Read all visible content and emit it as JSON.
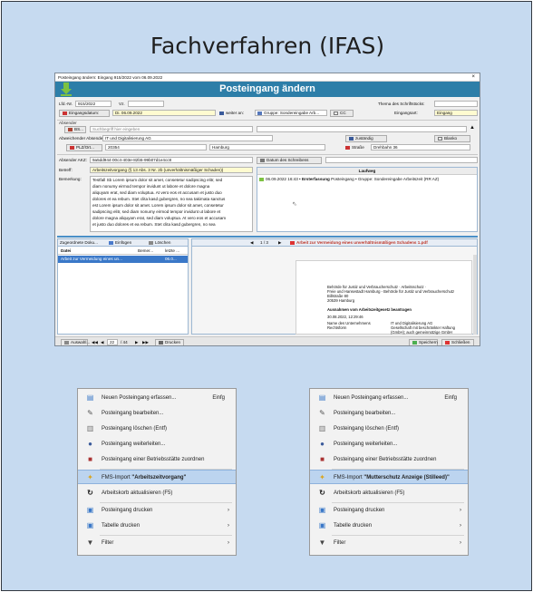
{
  "slide_title": "Fachverfahren (IFAS)",
  "window": {
    "titlebar": "Posteingang ändern: Eingang 915/2022 vom 06.09.2022",
    "close": "×",
    "header": "Posteingang ändern"
  },
  "form": {
    "lfd_label": "Lfd.-Nr.",
    "lfd_value": "915/2022",
    "vz_label": "Vz.",
    "theme_label": "Thema des Schriftstücks:",
    "eingangsdatum_label": "Eingangsdatum:",
    "eingangsdatum_value": "Di. 06.09.2022",
    "weiter_an": "weiter an:",
    "gruppe": "Gruppe: Sondereingabe Arb...",
    "cc": "CC",
    "eingangsart_label": "Eingangsart:",
    "eingangsart_value": "Eingang",
    "absender_label": "Absender",
    "bs": "BS...",
    "suchbegriff_placeholder": "Suchbegriff hier eingeben",
    "abw_absender_label": "Abweichender Absender:",
    "abw_absender_value": "IT und Digitalisierung AG",
    "zustaendig": "zuständig",
    "blanko": "Blanko",
    "plz_label": "PLZ/Ort...",
    "plz_value": "20354",
    "ort_value": "Hamburg",
    "strasse": "Straße",
    "strasse_value": "Drehbahn 36",
    "akz_label": "Absender AKZ:",
    "akz_value": "9a5dd944-00c4-403e-82b5-99b07d1e4cc8",
    "datum_schreiben": "Datum des Schreibens",
    "betreff_label": "Betreff:",
    "betreff_value": "Arbeitszeitvorgang (§ 13 Abs. 3 Nr. 2b (unverhältnismäßiger Schaden))",
    "bemerkung_label": "Bemerkung:",
    "bemerkung_text": [
      "Testfall Sb Lorem ipsum dolor sit amet, consetetur sadipscing elitr, sed",
      "diam nonumy eirmod tempor invidunt ut labore et dolore magna",
      "aliquyam erat, sed diam voluptua. At vero eos et accusam et justo duo",
      "dolores et ea rebum. Stet clita kasd gubergren, no sea takimata sanctus",
      "est Lorem ipsum dolor sit amet. Lorem ipsum dolor sit amet, consetetur",
      "sadipscing elitr, sed diam nonumy eirmod tempor invidunt ut labore et",
      "dolore magna aliquyam erat, sed diam voluptua. At vero eos et accusam",
      "et justo duo dolores et ea rebum. Stet clita kasd gubergren, no sea"
    ],
    "laufweg_header": "Laufweg",
    "laufweg_entry_date": "06.09.2022 16:43 •",
    "laufweg_entry_bold": "Ersterfassung",
    "laufweg_entry_rest": "Posteingang • Gruppe: Sondereingabe Arbeitszeit (RR AZ)"
  },
  "attachments": {
    "tab": "Zugeordnete Doku...",
    "einfuegen": "Einfügen",
    "loeschen": "Löschen",
    "col_datei": "Datei",
    "col_bemerkung": "Bemer...",
    "col_letzte": "letzte ...",
    "row_name": "Arbeit zur Vermeidung eines un...",
    "row_meta": "06.0..."
  },
  "viewer": {
    "page": "1 / 3",
    "filename": "Arbeit zur Vermeidung eines unverhältnismäßigen Schadens 1.pdf",
    "doc_lines": [
      "Behörde für Justiz und Verbraucherschutz · Arbeitsschutz ·",
      "Freie und Hansestadt Hamburg - Behörde für Justiz und Verbraucherschutz",
      "Billstraße 80",
      "20539 Hamburg"
    ],
    "doc_heading": "Ausnahmen vom Arbeitszeitgesetz beantragen",
    "doc_date": "30.08.2022, 12:29:46",
    "rows": [
      {
        "k": "Name des Unternehmens",
        "v": "IT und Digitalisierung AG"
      },
      {
        "k": "Rechtsform",
        "v": "Gesellschaft mit beschränkter Haftung"
      },
      {
        "k": "",
        "v": "(GmbH); auch gemeinnützige GmbH"
      },
      {
        "k": "",
        "v": "(gGmbH)"
      },
      {
        "k": "E-Mail",
        "v": "OnlineDienste@justiz.hamburg.de"
      }
    ]
  },
  "bottom": {
    "auswahl": "Auswahl...",
    "nav_pos": "22",
    "nav_total": "/ 44",
    "drucken": "Drucken",
    "speichern": "Speichern",
    "schliessen": "Schließen"
  },
  "menu_left": {
    "items": [
      {
        "icon": "new-document-icon",
        "label": "Neuen Posteingang erfassen...",
        "shortcut": "Einfg"
      },
      {
        "icon": "edit-pencil-icon",
        "label": "Posteingang bearbeiten..."
      },
      {
        "icon": "trash-icon",
        "label": "Posteingang löschen (Entf)"
      },
      {
        "icon": "user-forward-icon",
        "label": "Posteingang weiterleiten..."
      },
      {
        "icon": "factory-icon",
        "label": "Posteingang einer Betriebsstätte zuordnen"
      },
      {
        "icon": "import-icon",
        "label_prefix": "FMS-Import ",
        "label_bold": "\"Arbeitszeitvorgang\"",
        "selected": true
      },
      {
        "icon": "refresh-icon",
        "label": "Arbeitskorb aktualisieren (F5)"
      },
      {
        "icon": "printer-icon",
        "label": "Posteingang drucken",
        "submenu": true
      },
      {
        "icon": "printer-table-icon",
        "label": "Tabelle drucken",
        "submenu": true
      },
      {
        "icon": "filter-icon",
        "label": "Filter",
        "submenu": true
      }
    ]
  },
  "menu_right": {
    "items": [
      {
        "icon": "new-document-icon",
        "label": "Neuen Posteingang erfassen...",
        "shortcut": "Einfg"
      },
      {
        "icon": "edit-pencil-icon",
        "label": "Posteingang bearbeiten..."
      },
      {
        "icon": "trash-icon",
        "label": "Posteingang löschen (Entf)"
      },
      {
        "icon": "user-forward-icon",
        "label": "Posteingang weiterleiten..."
      },
      {
        "icon": "factory-icon",
        "label": "Posteingang einer Betriebsstätte zuordnen"
      },
      {
        "icon": "import-icon",
        "label_prefix": "FMS-Import ",
        "label_bold": "\"Mutterschutz Anzeige (Stilleed)\"",
        "selected": true
      },
      {
        "icon": "refresh-icon",
        "label": "Arbeitskorb aktualisieren (F5)"
      },
      {
        "icon": "printer-icon",
        "label": "Posteingang drucken",
        "submenu": true
      },
      {
        "icon": "printer-table-icon",
        "label": "Tabelle drucken",
        "submenu": true
      },
      {
        "icon": "filter-icon",
        "label": "Filter",
        "submenu": true
      }
    ]
  }
}
